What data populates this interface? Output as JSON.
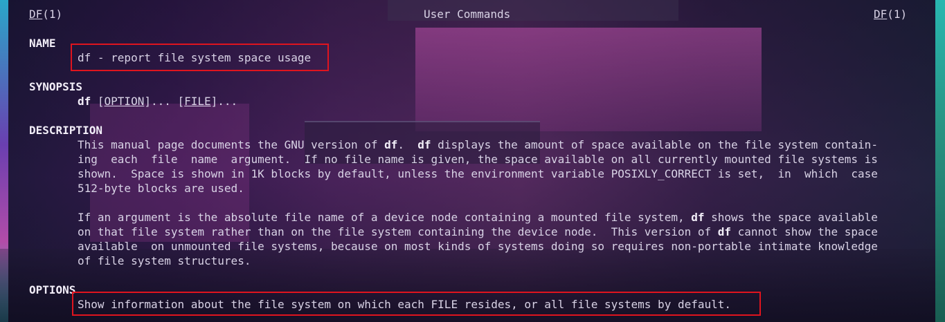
{
  "header": {
    "left_name": "DF",
    "left_section": "(1)",
    "center": "User Commands",
    "right_name": "DF",
    "right_section": "(1)"
  },
  "sections": {
    "name": {
      "heading": "NAME",
      "text": "df - report file system space usage"
    },
    "synopsis": {
      "heading": "SYNOPSIS",
      "cmd": "df",
      "sp1": " [",
      "option": "OPTION",
      "mid": "]... [",
      "file": "FILE",
      "end": "]..."
    },
    "description": {
      "heading": "DESCRIPTION",
      "p1": {
        "l1a": "This manual page documents the GNU version of ",
        "l1b": "df",
        "l1c": ".  ",
        "l1d": "df",
        "l1e": " displays the amount of space available on the file system contain-",
        "l2": "ing  each  file  name  argument.  If no file name is given, the space available on all currently mounted file systems is",
        "l3": "shown.  Space is shown in 1K blocks by default, unless the environment variable POSIXLY_CORRECT is set,  in  which  case",
        "l4": "512-byte blocks are used."
      },
      "p2": {
        "l1a": "If an argument is the absolute file name of a device node containing a mounted file system, ",
        "l1b": "df",
        "l1c": " shows the space available",
        "l2a": "on that file system rather than on the file system containing the device node.  This version of ",
        "l2b": "df",
        "l2c": " cannot show the space",
        "l3": "available  on unmounted file systems, because on most kinds of systems doing so requires non-portable intimate knowledge",
        "l4": "of file system structures."
      }
    },
    "options": {
      "heading": "OPTIONS",
      "text": "Show information about the file system on which each FILE resides, or all file systems by default."
    }
  },
  "colors": {
    "highlight": "#e0141e",
    "text": "#d9d3e6"
  }
}
